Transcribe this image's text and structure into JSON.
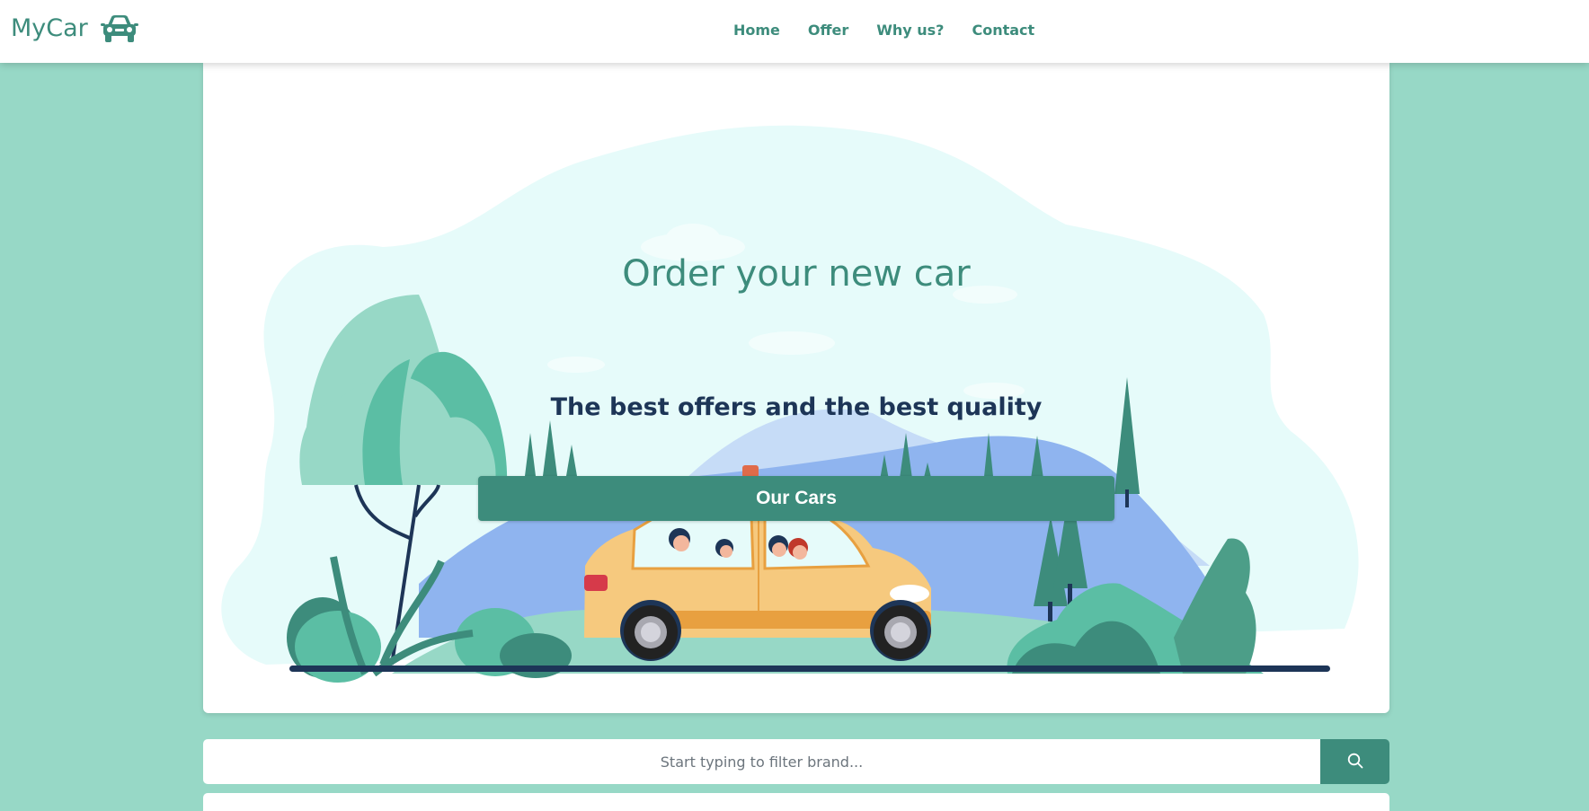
{
  "navbar": {
    "brand": "MyCar",
    "brand_icon": "car-icon",
    "links": [
      {
        "label": "Home"
      },
      {
        "label": "Offer"
      },
      {
        "label": "Why us?"
      },
      {
        "label": "Contact"
      }
    ]
  },
  "hero": {
    "title": "Order your new car",
    "subtitle": "The best offers and the best quality",
    "cta_label": "Our Cars",
    "illustration": "family-road-trip-illustration"
  },
  "search": {
    "placeholder": "Start typing to filter brand...",
    "button_icon": "search-icon"
  },
  "colors": {
    "accent": "#3d8c7c",
    "background": "#97d8c6",
    "heading_dark": "#1d3557",
    "card": "#ffffff"
  }
}
